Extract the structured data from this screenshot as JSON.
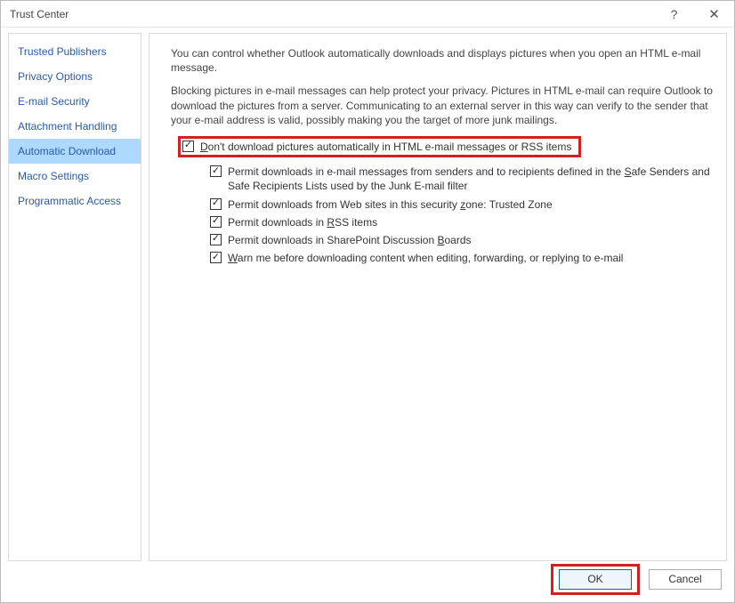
{
  "window": {
    "title": "Trust Center",
    "help": "?",
    "close": "✕"
  },
  "sidebar": {
    "items": [
      {
        "label": "Trusted Publishers"
      },
      {
        "label": "Privacy Options"
      },
      {
        "label": "E-mail Security"
      },
      {
        "label": "Attachment Handling"
      },
      {
        "label": "Automatic Download"
      },
      {
        "label": "Macro Settings"
      },
      {
        "label": "Programmatic Access"
      }
    ]
  },
  "content": {
    "para1": "You can control whether Outlook automatically downloads and displays pictures when you open an HTML e-mail message.",
    "para2": "Blocking pictures in e-mail messages can help protect your privacy. Pictures in HTML e-mail can require Outlook to download the pictures from a server. Communicating to an external server in this way can verify to the sender that your e-mail address is valid, possibly making you the target of more junk mailings.",
    "options": {
      "o1_pre": "D",
      "o1_rest": "on't download pictures automatically in HTML e-mail messages or RSS items",
      "o2_pre": "Permit downloads in e-mail messages from senders and to recipients defined in the ",
      "o2_u": "S",
      "o2_mid": "afe Senders and Safe Recipients Lists used by the Junk E-mail filter",
      "o3_pre": "Permit downloads from Web sites in this security ",
      "o3_u": "z",
      "o3_rest": "one: Trusted Zone",
      "o4_pre": "Permit downloads in ",
      "o4_u": "R",
      "o4_rest": "SS items",
      "o5_pre": "Permit downloads in SharePoint Discussion ",
      "o5_u": "B",
      "o5_rest": "oards",
      "o6_u": "W",
      "o6_rest": "arn me before downloading content when editing, forwarding, or replying to e-mail"
    }
  },
  "footer": {
    "ok": "OK",
    "cancel": "Cancel"
  }
}
